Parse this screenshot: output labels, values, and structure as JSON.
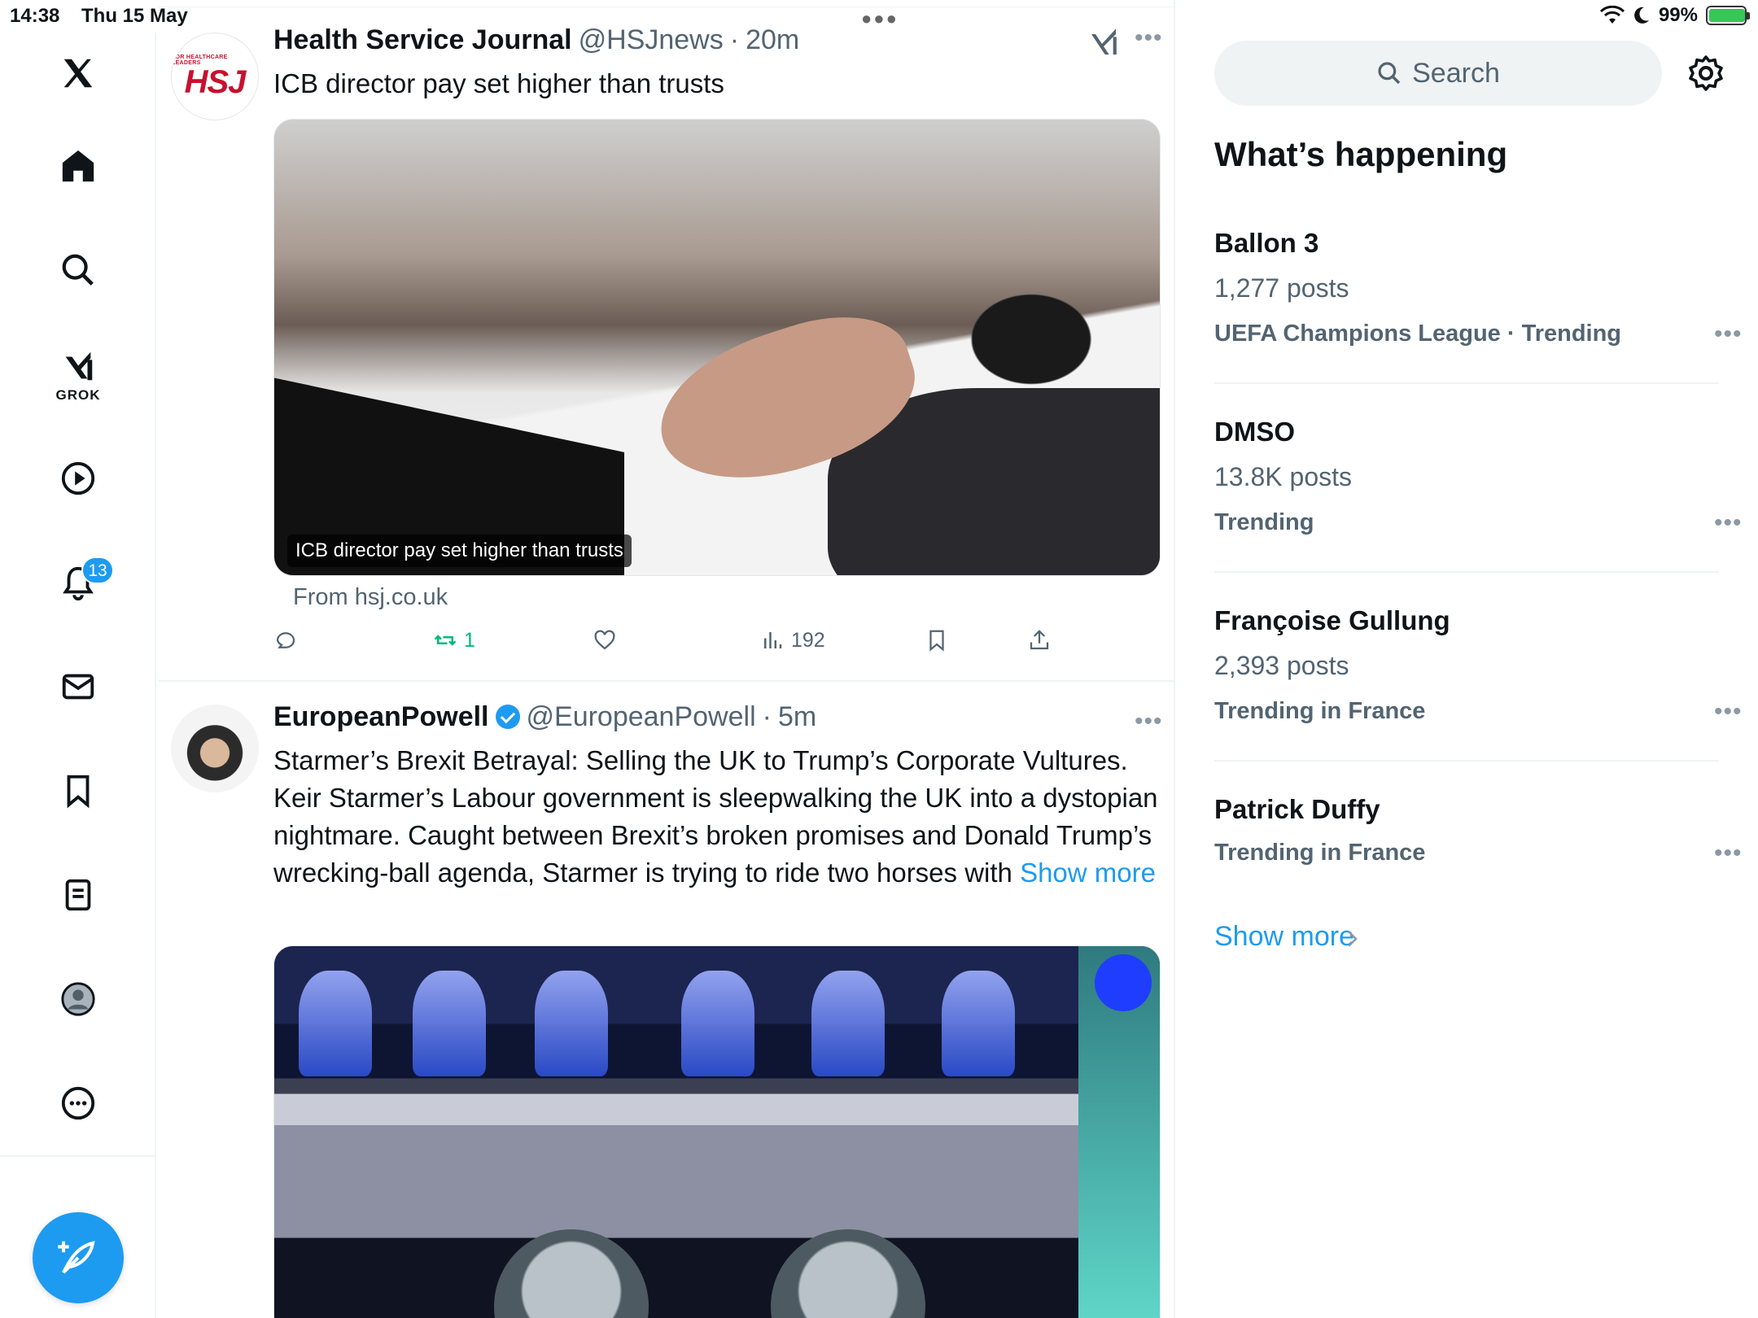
{
  "status_bar": {
    "time": "14:38",
    "date": "Thu 15 May",
    "battery": "99%",
    "battery_level": 0.99
  },
  "nav": {
    "grok_label": "GROK",
    "notifications_count": "13",
    "items": [
      "x-logo-icon",
      "home-icon",
      "search-icon",
      "grok-icon",
      "video-icon",
      "notifications-icon",
      "messages-icon",
      "bookmarks-icon",
      "lists-icon",
      "profile-icon",
      "more-icon"
    ]
  },
  "tweets": [
    {
      "name": "Health Service Journal",
      "handle": "@HSJnews",
      "sep": "·",
      "time": "20m",
      "avatar_tagline": "FOR HEALTHCARE LEADERS",
      "avatar_logo": "HSJ",
      "text": "ICB director pay set higher than trusts",
      "media_caption": "ICB director pay set higher than trusts",
      "link_source": "From hsj.co.uk",
      "retweets": "1",
      "views": "192"
    },
    {
      "name": "EuropeanPowell",
      "handle": "@EuropeanPowell",
      "sep": "·",
      "time": "5m",
      "text": "Starmer’s Brexit Betrayal: Selling the UK to Trump’s Corporate Vultures. Keir Starmer’s Labour government is sleepwalking the UK into a dystopian nightmare. Caught between Brexit’s broken promises and Donald Trump’s wrecking-ball agenda, Starmer is trying to ride two horses with",
      "show_more": "Show more"
    }
  ],
  "search": {
    "placeholder": "Search"
  },
  "whats_happening": {
    "title": "What’s happening",
    "trends": [
      {
        "name": "Ballon 3",
        "posts": "1,277 posts",
        "context": "UEFA Champions League · Trending"
      },
      {
        "name": "DMSO",
        "posts": "13.8K posts",
        "context": "Trending"
      },
      {
        "name": "Françoise Gullung",
        "posts": "2,393 posts",
        "context": "Trending in France"
      },
      {
        "name": "Patrick Duffy",
        "posts": "",
        "context": "Trending in France"
      }
    ],
    "show_more": "Show more"
  },
  "colors": {
    "accent": "#1d9bf0",
    "retweet": "#00ba7c",
    "secondary_text": "#536471"
  }
}
